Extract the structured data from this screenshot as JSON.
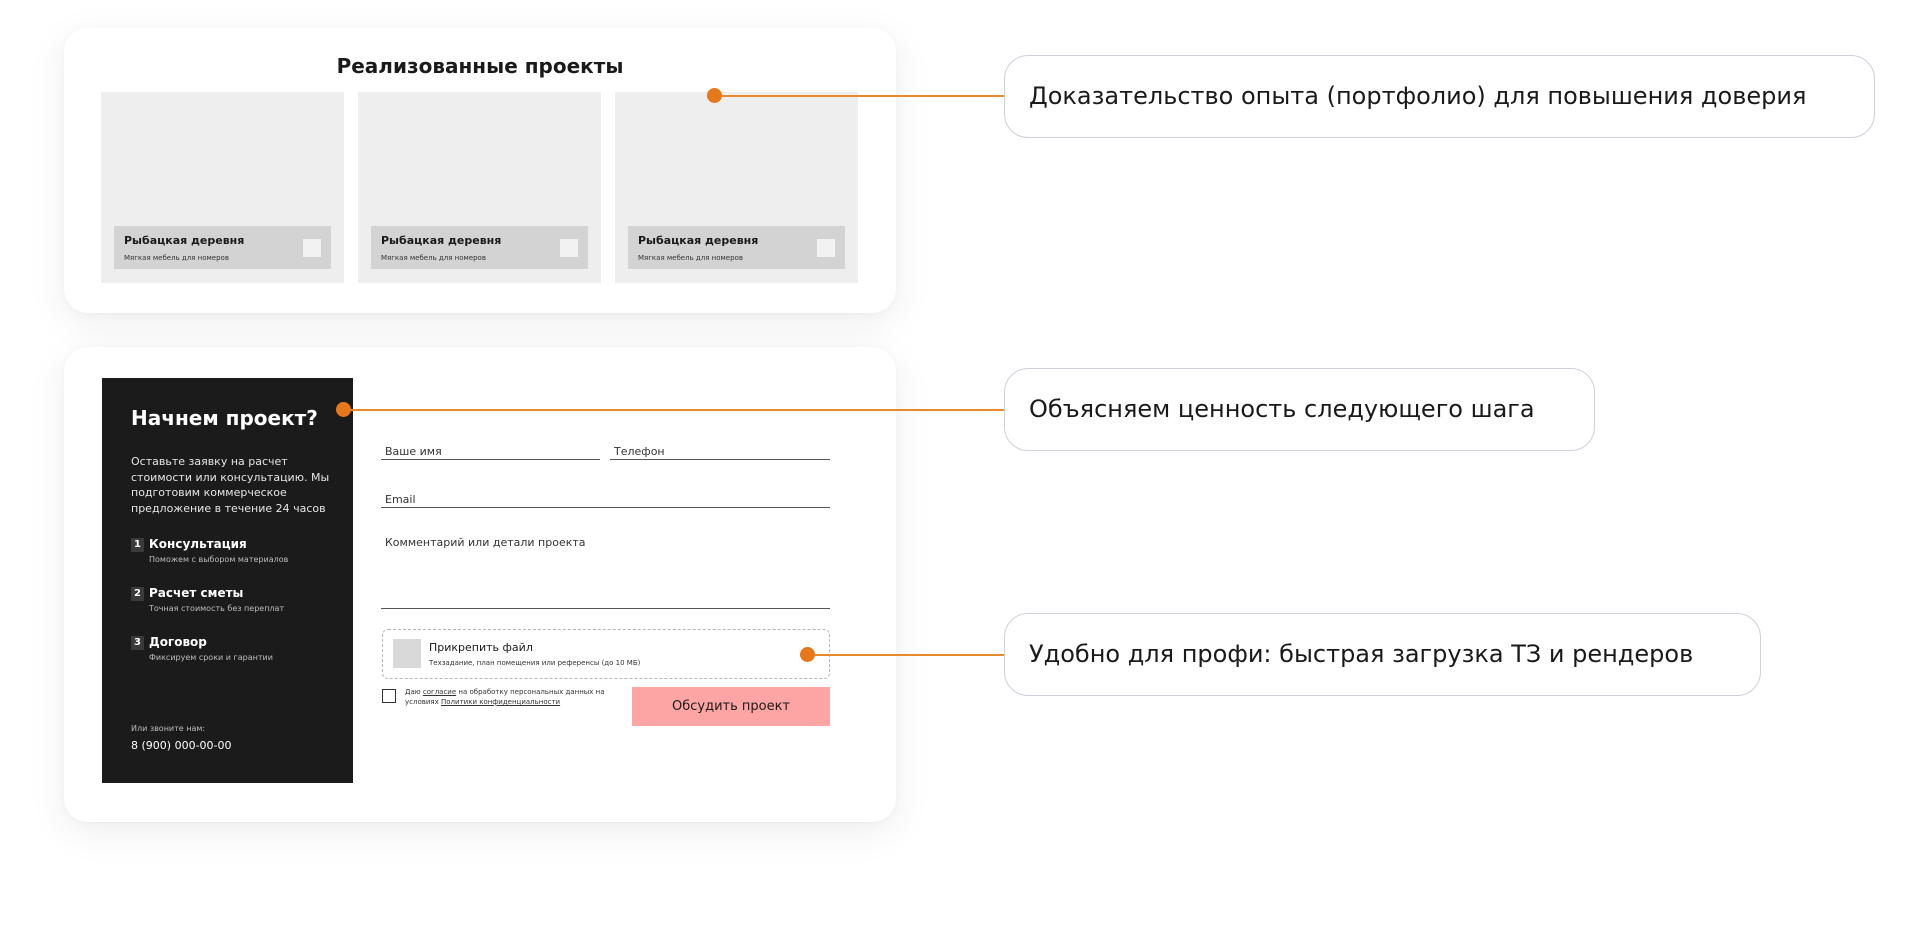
{
  "projects": {
    "title": "Реализованные проекты",
    "items": [
      {
        "name": "Рыбацкая деревня",
        "desc": "Мягкая мебель для номеров"
      },
      {
        "name": "Рыбацкая деревня",
        "desc": "Мягкая мебель для номеров"
      },
      {
        "name": "Рыбацкая деревня",
        "desc": "Мягкая мебель для номеров"
      }
    ]
  },
  "form": {
    "title": "Начнем проект?",
    "description": "Оставьте заявку на расчет стоимости или консультацию. Мы подготовим коммерческое предложение в течение 24 часов",
    "steps": [
      {
        "num": "1",
        "title": "Консультация",
        "sub": "Поможем с выбором материалов"
      },
      {
        "num": "2",
        "title": "Расчет сметы",
        "sub": "Точная стоимость без переплат"
      },
      {
        "num": "3",
        "title": "Договор",
        "sub": "Фиксируем сроки и гарантии"
      }
    ],
    "call_label": "Или звоните нам:",
    "phone": "8 (900) 000-00-00",
    "name_placeholder": "Ваше имя",
    "phone_placeholder": "Телефон",
    "email_placeholder": "Email",
    "comment_placeholder": "Комментарий или детали проекта",
    "attach_title": "Прикрепить файл",
    "attach_sub": "Техзадание, план помещения или референсы (до 10 МБ)",
    "consent_prefix": "Даю",
    "consent_link1": "согласие",
    "consent_middle": "на обработку персональных данных на условиях",
    "consent_link2": "Политики конфиденциальности",
    "submit_label": "Обсудить проект"
  },
  "callouts": [
    "Доказательство опыта (портфолио) для повышения доверия",
    "Объясняем ценность следующего шага",
    "Удобно для профи: быстрая загрузка ТЗ и рендеров"
  ],
  "colors": {
    "accent": "#e6781a",
    "button": "#fda4a4",
    "panel": "#1b1b1b"
  }
}
